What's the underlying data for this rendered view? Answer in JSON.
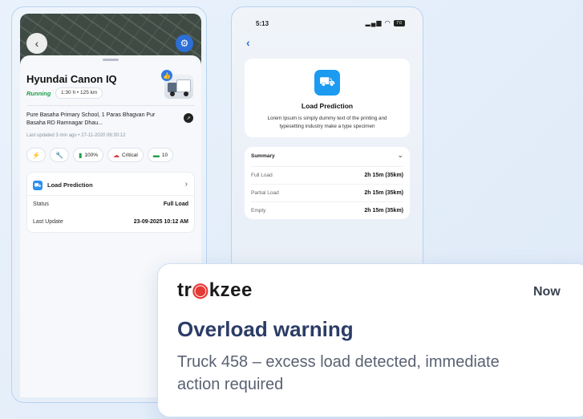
{
  "left_phone": {
    "vehicle_name": "Hyundai Canon IQ",
    "status": "Running",
    "duration": "1:30 h  •  125 km",
    "address": "Pure Basaha Primary School, 1 Paras Bhagvan Pur Basaha RD Ramnagar Dhau...",
    "last_updated": "Last updated 3 min ago  •  27-11-2020 06:30:12",
    "chips": {
      "fuel_label": "100%",
      "critical_label": "Critical",
      "count_label": "10"
    },
    "load_card": {
      "title": "Load Prediction",
      "status_label": "Status",
      "status_value": "Full Load",
      "last_update_label": "Last Update",
      "last_update_value": "23-09-2025 10:12 AM"
    }
  },
  "right_phone": {
    "time": "5:13",
    "battery": "70",
    "load_card": {
      "title": "Load Prediction",
      "description": "Lorem Ipsum is simply dummy text of the printing and typesetting industry make a type specimen"
    },
    "summary": {
      "title": "Summary",
      "rows": [
        {
          "label": "Full Load",
          "value": "2h 15m (35km)"
        },
        {
          "label": "Partial Load",
          "value": "2h 15m (35km)"
        },
        {
          "label": "Empty",
          "value": "2h 15m (35km)"
        }
      ]
    }
  },
  "notification": {
    "brand_pre": "tr",
    "brand_post": "kzee",
    "time": "Now",
    "title": "Overload warning",
    "body": "Truck 458 – excess load detected, immediate action required"
  },
  "colors": {
    "accent": "#2c6fd6",
    "running": "#1e9e4a",
    "critical": "#e03a3a",
    "warning_title": "#2b3c66"
  }
}
